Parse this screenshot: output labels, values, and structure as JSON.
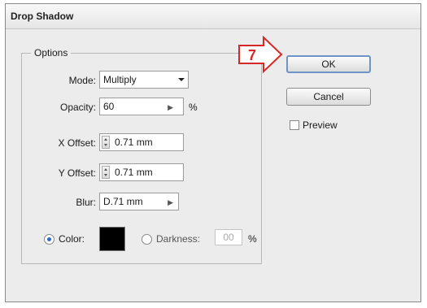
{
  "dialog": {
    "title": "Drop Shadow"
  },
  "options": {
    "legend": "Options",
    "mode": {
      "label": "Mode:",
      "value": "Multiply"
    },
    "opacity": {
      "label": "Opacity:",
      "value": "60",
      "unit": "%"
    },
    "x_offset": {
      "label": "X Offset:",
      "value": "0.71 mm"
    },
    "y_offset": {
      "label": "Y Offset:",
      "value": "0.71 mm"
    },
    "blur": {
      "label": "Blur:",
      "value": "D.71 mm"
    },
    "color": {
      "label": "Color:",
      "selected": true,
      "swatch": "#000000"
    },
    "darkness": {
      "label": "Darkness:",
      "value": "00",
      "unit": "%",
      "selected": false
    }
  },
  "buttons": {
    "ok": "OK",
    "cancel": "Cancel"
  },
  "preview": {
    "label": "Preview",
    "checked": false
  },
  "callout": {
    "number": "7",
    "color": "#d62828"
  }
}
